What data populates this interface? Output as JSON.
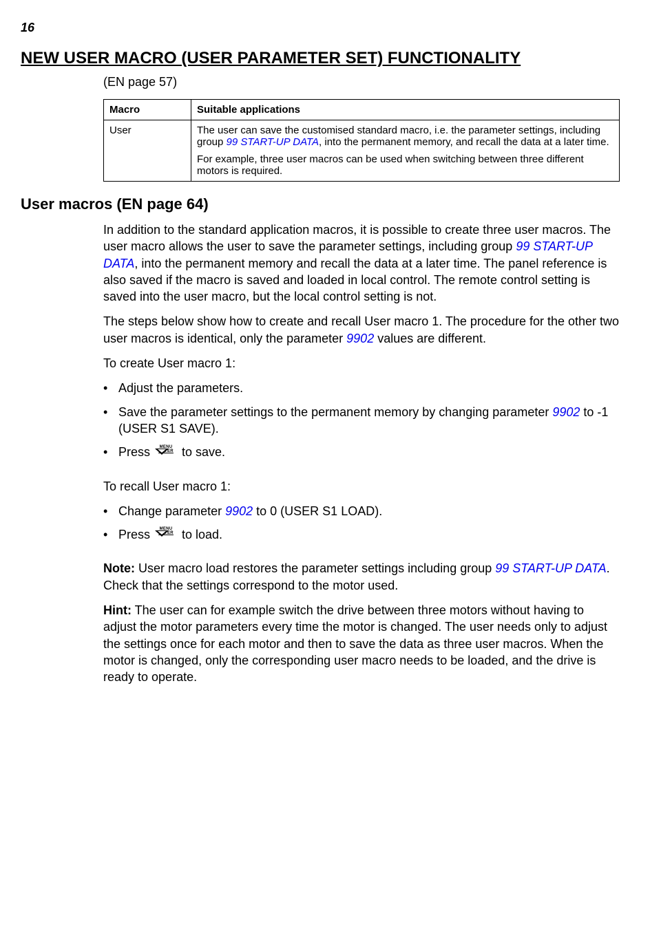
{
  "page_number": "16",
  "main_title": "NEW USER MACRO (USER PARAMETER SET) FUNCTIONALITY",
  "sub_ref_1": "(EN page 57)",
  "table": {
    "head_col1": "Macro",
    "head_col2": "Suitable applications",
    "row1_col1": "User",
    "row1_col2_p1_a": "The user can save the customised standard macro, i.e. the parameter settings, including group ",
    "row1_col2_p1_link": "99 START-UP DATA",
    "row1_col2_p1_b": ", into the permanent memory, and recall the data at a later time.",
    "row1_col2_p2": "For example, three user macros can be used when switching between three different motors is required."
  },
  "section_title": "User macros (EN page 64)",
  "para1_a": "In addition to the standard application macros, it is possible to create three user macros. The user macro allows the user to save the parameter settings, including group ",
  "para1_link": "99 START-UP DATA",
  "para1_b": ", into the permanent memory and recall the data at a later time. The panel reference is also saved if the macro is saved and loaded in local control. The remote control setting is saved into the user macro, but the local control setting is not.",
  "para2_a": "The steps below show how to create and recall User macro 1. The procedure for the other two user macros is identical, only the parameter ",
  "para2_link": "9902",
  "para2_b": " values are different.",
  "para3": "To create User macro 1:",
  "bullet1": "Adjust the parameters.",
  "bullet2_a": "Save the parameter settings to the permanent memory by changing parameter ",
  "bullet2_link": "9902",
  "bullet2_b": " to -1 (USER S1 SAVE).",
  "bullet3_a": "Press ",
  "bullet3_b": " to save.",
  "para4": "To recall User macro 1:",
  "bullet4_a": "Change parameter ",
  "bullet4_link": "9902",
  "bullet4_b": " to 0 (USER S1 LOAD).",
  "bullet5_a": "Press ",
  "bullet5_b": " to load.",
  "note_label": "Note:",
  "note_a": " User macro load restores the parameter settings including group ",
  "note_link": "99 START-UP DATA",
  "note_b": ". Check that the settings correspond to the motor used.",
  "hint_label": "Hint:",
  "hint_text": " The user can for example switch the drive between three motors without having to adjust the motor parameters every time the motor is changed. The user needs only to adjust the settings once for each motor and then to save the data as three user macros. When the motor is changed, only the corresponding user macro needs to be loaded, and the drive is ready to operate.",
  "key_label_1": "MENU",
  "key_label_2": "ENTER"
}
